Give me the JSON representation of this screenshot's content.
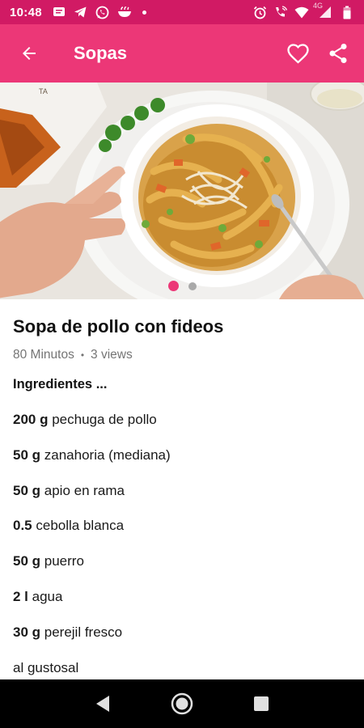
{
  "status_bar": {
    "time": "10:48",
    "network_label": "4G",
    "left_icons": [
      "message-icon",
      "telegram-icon",
      "whatsapp-icon",
      "food-app-icon"
    ],
    "right_icons": [
      "alarm-icon",
      "wifi-calling-icon",
      "wifi-icon",
      "signal-icon",
      "battery-icon"
    ]
  },
  "app_bar": {
    "title": "Sopas",
    "color": "#ec3777",
    "status_color": "#d11a64"
  },
  "hero": {
    "pager_total": 2,
    "pager_active": 1,
    "accent": "#ec3777"
  },
  "recipe": {
    "title": "Sopa de pollo con fideos",
    "duration": "80 Minutos",
    "separator": "•",
    "views": "3 views",
    "ingredients_header": "Ingredientes ...",
    "ingredients": [
      {
        "qty": "200 g",
        "name": " pechuga de pollo"
      },
      {
        "qty": "50 g",
        "name": " zanahoria (mediana)"
      },
      {
        "qty": "50 g",
        "name": " apio en rama"
      },
      {
        "qty": "0.5",
        "name": " cebolla blanca"
      },
      {
        "qty": "50 g",
        "name": " puerro"
      },
      {
        "qty": "2 l",
        "name": " agua"
      },
      {
        "qty": "30 g",
        "name": " perejil fresco"
      },
      {
        "qty": "",
        "name": "al gustosal"
      }
    ]
  },
  "nav_bar": {
    "buttons": [
      "back-nav",
      "home-nav",
      "recents-nav"
    ]
  }
}
